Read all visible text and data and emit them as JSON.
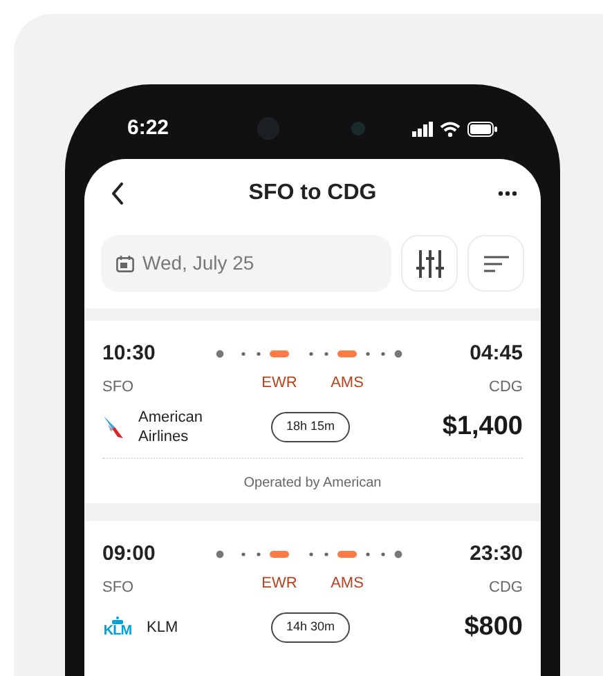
{
  "status_bar": {
    "time": "6:22"
  },
  "header": {
    "title": "SFO to CDG"
  },
  "date_field": {
    "value": "Wed, July 25"
  },
  "flights": [
    {
      "depart_time": "10:30",
      "arrive_time": "04:45",
      "origin": "SFO",
      "destination": "CDG",
      "stops": [
        "EWR",
        "AMS"
      ],
      "airline": "American Airlines",
      "kind": "american",
      "duration": "18h 15m",
      "price": "$1,400",
      "operated_by": "Operated by American"
    },
    {
      "depart_time": "09:00",
      "arrive_time": "23:30",
      "origin": "SFO",
      "destination": "CDG",
      "stops": [
        "EWR",
        "AMS"
      ],
      "airline": "KLM",
      "kind": "klm",
      "logo_text": "KLM",
      "duration": "14h 30m",
      "price": "$800"
    }
  ]
}
